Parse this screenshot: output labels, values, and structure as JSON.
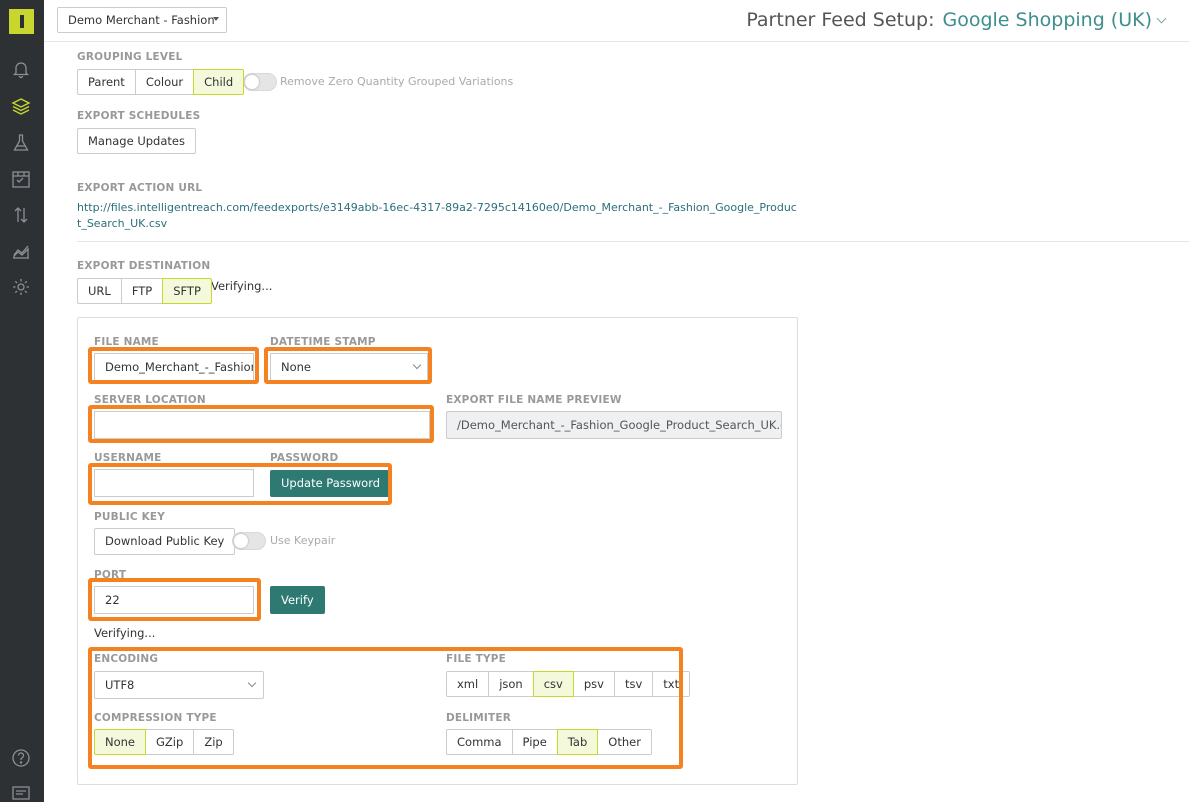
{
  "header": {
    "merchant": "Demo Merchant - Fashion",
    "title": "Partner Feed Setup:",
    "feed": "Google Shopping (UK)"
  },
  "grouping": {
    "label": "GROUPING LEVEL",
    "options": [
      "Parent",
      "Colour",
      "Child"
    ],
    "selected": "Child",
    "toggle_label": "Remove Zero Quantity Grouped Variations"
  },
  "schedules": {
    "label": "EXPORT SCHEDULES",
    "button": "Manage Updates"
  },
  "action_url": {
    "label": "EXPORT ACTION URL",
    "url": "http://files.intelligentreach.com/feedexports/e3149abb-16ec-4317-89a2-7295c14160e0/Demo_Merchant_-_Fashion_Google_Product_Search_UK.csv"
  },
  "destination": {
    "label": "EXPORT DESTINATION",
    "options": [
      "URL",
      "FTP",
      "SFTP"
    ],
    "selected": "SFTP",
    "status": "Verifying..."
  },
  "form": {
    "file_name_label": "FILE NAME",
    "file_name": "Demo_Merchant_-_Fashion",
    "datetime_label": "DATETIME STAMP",
    "datetime": "None",
    "server_label": "SERVER LOCATION",
    "server": "",
    "preview_label": "EXPORT FILE NAME PREVIEW",
    "preview": "/Demo_Merchant_-_Fashion_Google_Product_Search_UK.csv",
    "username_label": "USERNAME",
    "username": "",
    "password_label": "PASSWORD",
    "password_button": "Update Password",
    "pubkey_label": "PUBLIC KEY",
    "pubkey_button": "Download Public Key",
    "keypair_label": "Use Keypair",
    "port_label": "PORT",
    "port": "22",
    "verify_button": "Verify",
    "verify_status": "Verifying...",
    "encoding_label": "ENCODING",
    "encoding": "UTF8",
    "filetype_label": "FILE TYPE",
    "filetypes": [
      "xml",
      "json",
      "csv",
      "psv",
      "tsv",
      "txt"
    ],
    "filetype_selected": "csv",
    "compression_label": "COMPRESSION TYPE",
    "compressions": [
      "None",
      "GZip",
      "Zip"
    ],
    "compression_selected": "None",
    "delimiter_label": "DELIMITER",
    "delimiters": [
      "Comma",
      "Pipe",
      "Tab",
      "Other"
    ],
    "delimiter_selected": "Tab"
  },
  "colors": {
    "sidebar": "#2d3134",
    "accent": "#c8d62d",
    "teal": "#2e7a72",
    "highlight": "#f58220"
  }
}
